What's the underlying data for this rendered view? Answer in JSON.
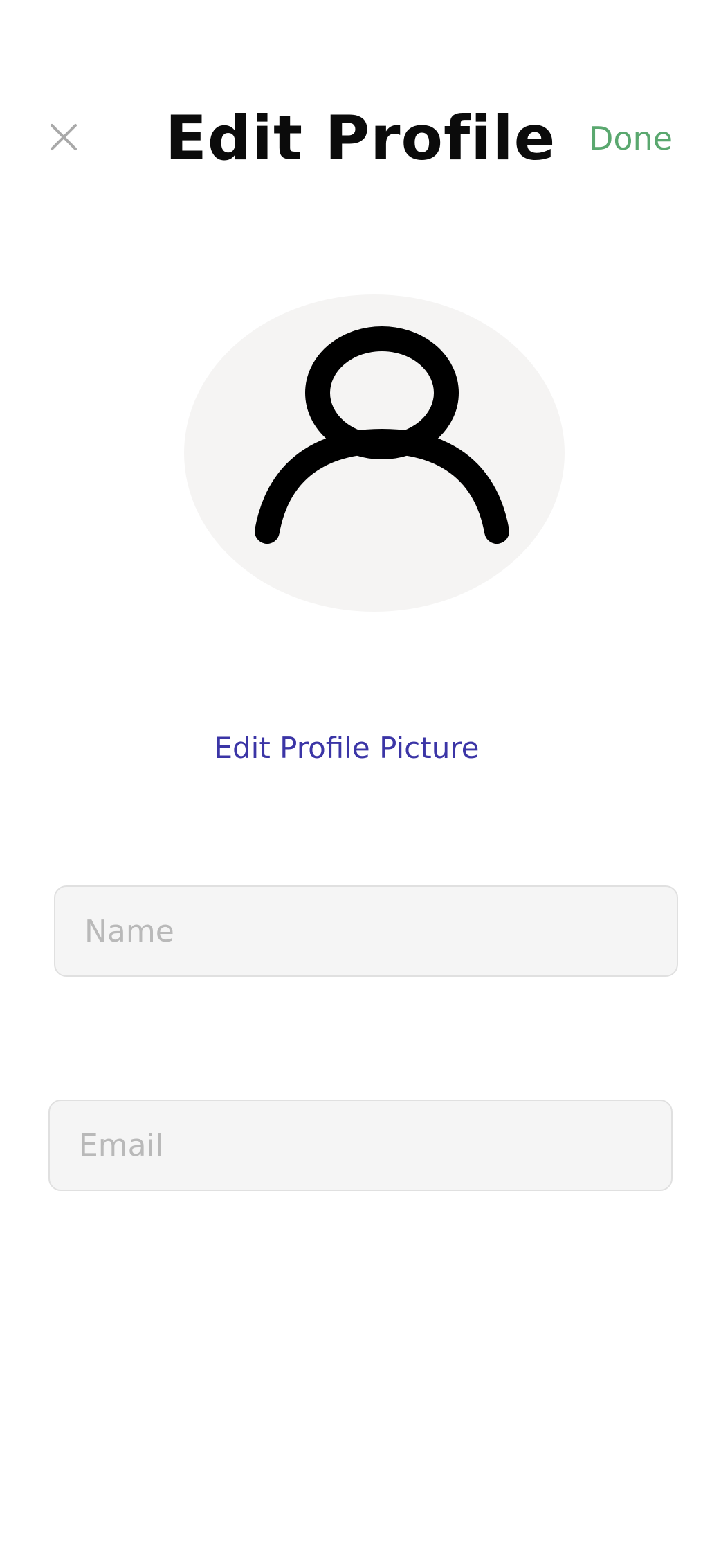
{
  "header": {
    "title": "Edit Profile",
    "close_icon": "close-icon",
    "done_label": "Done"
  },
  "avatar": {
    "icon": "person-icon",
    "edit_label": "Edit Profile Picture"
  },
  "form": {
    "name": {
      "value": "",
      "placeholder": "Name"
    },
    "email": {
      "value": "",
      "placeholder": "Email"
    }
  },
  "colors": {
    "done": "#5aa86f",
    "edit_link": "#3b35a6",
    "avatar_bg": "#f5f4f3",
    "field_bg": "#f5f5f5",
    "placeholder": "#b9b9b9"
  }
}
